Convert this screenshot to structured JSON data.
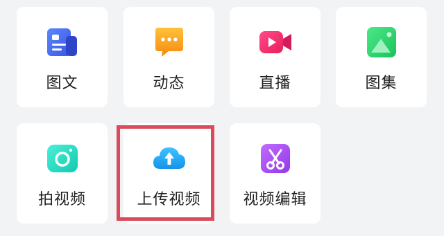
{
  "tiles": [
    {
      "id": "tuwen",
      "label": "图文",
      "icon": "document-icon",
      "color": "#4a6cf7"
    },
    {
      "id": "dongtai",
      "label": "动态",
      "icon": "chat-bubble-icon",
      "color": "#f7a320"
    },
    {
      "id": "zhibo",
      "label": "直播",
      "icon": "video-camera-icon",
      "color": "#f0326e"
    },
    {
      "id": "tuji",
      "label": "图集",
      "icon": "image-icon",
      "color": "#2bd16b"
    },
    {
      "id": "paishipin",
      "label": "拍视频",
      "icon": "camera-icon",
      "color": "#1fd6c0"
    },
    {
      "id": "shangchuan",
      "label": "上传视频",
      "icon": "cloud-upload-icon",
      "color": "#1aa8f0",
      "highlighted": true
    },
    {
      "id": "bianji",
      "label": "视频编辑",
      "icon": "scissors-icon",
      "color": "#a44ff0"
    }
  ],
  "colors": {
    "background": "#f2f3f5",
    "tile": "#ffffff",
    "highlight_border": "#d94a5a",
    "label": "#1f1f1f"
  }
}
